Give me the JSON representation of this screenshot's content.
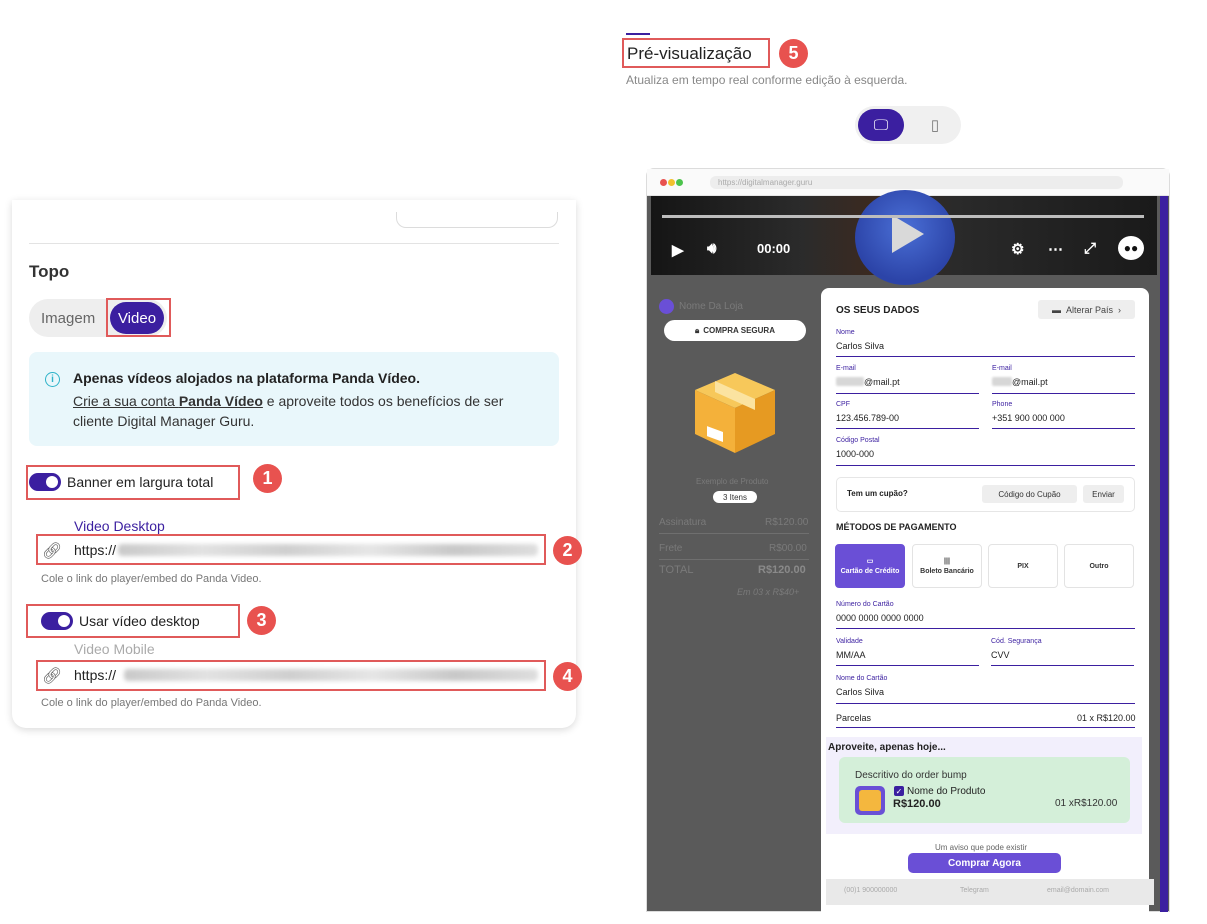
{
  "left": {
    "section_title": "Topo",
    "segment": {
      "image_label": "Imagem",
      "video_label": "Video",
      "selected": "Video"
    },
    "info": {
      "title": "Apenas vídeos alojados na plataforma Panda Vídeo.",
      "line1_pre": "Crie a sua conta ",
      "line1_link": "Panda Vídeo",
      "line1_post": " e aproveite todos os benefícios de ser",
      "line2": "cliente Digital Manager Guru."
    },
    "banner_toggle": {
      "label": "Banner em largura total",
      "on": true
    },
    "video_desktop": {
      "label": "Video Desktop",
      "value": "https://",
      "hint": "Cole o link do player/embed do Panda Video."
    },
    "use_desktop_toggle": {
      "label": "Usar vídeo desktop",
      "on": true
    },
    "video_mobile": {
      "label": "Video Mobile",
      "value": "https://",
      "hint": "Cole o link do player/embed do Panda Video."
    }
  },
  "annotations": [
    "1",
    "2",
    "3",
    "4",
    "5"
  ],
  "preview": {
    "title": "Pré-visualização",
    "subtitle": "Atualiza em tempo real conforme edição à esquerda.",
    "device_selected": "desktop",
    "address": "https://digitalmanager.guru",
    "video": {
      "time": "00:00"
    },
    "store_name": "Nome Da Loja",
    "secure_label": "COMPRA SEGURA",
    "product_name": "Exemplo de Produto",
    "items": "3 Itens",
    "summary": {
      "subscription_label": "Assinatura",
      "subscription_value": "R$120.00",
      "shipping_label": "Frete",
      "shipping_value": "R$00.00",
      "total_label": "TOTAL",
      "total_value": "R$120.00",
      "installments": "Em 03 x R$40+"
    },
    "form": {
      "title": "OS SEUS DADOS",
      "country_btn": "Alterar País",
      "name_label": "Nome",
      "name_value": "Carlos Silva",
      "email_label": "E-mail",
      "email_value": "@mail.pt",
      "email2_label": "E-mail",
      "email2_value": "@mail.pt",
      "cpf_label": "CPF",
      "cpf_value": "123.456.789-00",
      "phone_label": "Phone",
      "phone_value": "+351 900 000 000",
      "cp_label": "Código Postal",
      "cp_value": "1000-000",
      "coupon_label": "Tem um cupão?",
      "coupon_placeholder": "Código do Cupão",
      "coupon_btn": "Enviar"
    },
    "payment": {
      "title": "MÉTODOS DE PAGAMENTO",
      "methods": [
        "Cartão de Crédito",
        "Boleto Bancário",
        "PIX",
        "Outro"
      ],
      "card_label": "Número do Cartão",
      "card_value": "0000 0000 0000 0000",
      "validity_label": "Validade",
      "validity_value": "MM/AA",
      "cvv_label": "Cód. Segurança",
      "cvv_value": "CVV",
      "holder_label": "Nome do Cartão",
      "holder_value": "Carlos Silva",
      "installments_label": "Parcelas",
      "installments_value": "01 x R$120.00"
    },
    "bump": {
      "title": "Aproveite, apenas hoje...",
      "description": "Descritivo do order bump",
      "product": "Nome do Produto",
      "price": "R$120.00",
      "qty": "01 xR$120.00"
    },
    "notice": "Um aviso que pode existir",
    "buy_label": "Comprar Agora",
    "footer": [
      "(00)1 900000000",
      "Telegram",
      "email@domain.com"
    ]
  }
}
